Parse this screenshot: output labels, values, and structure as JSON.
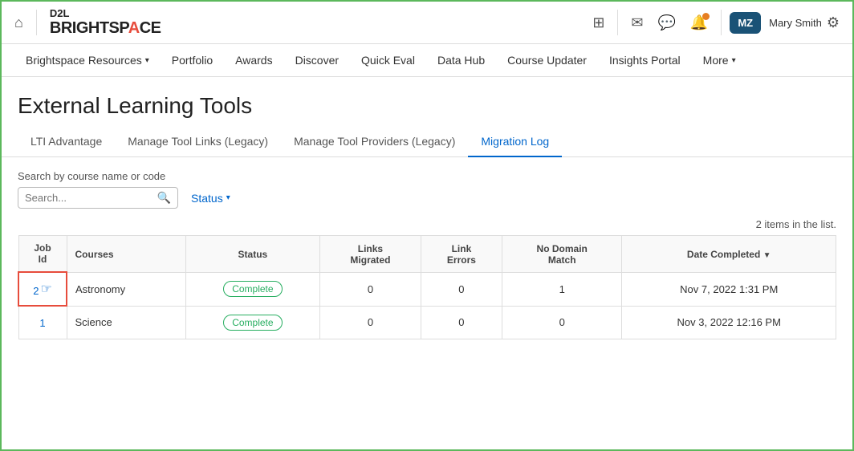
{
  "topbar": {
    "logo_d2l": "D2L",
    "logo_bright": "BRIGHTSP",
    "logo_ace": "ACE",
    "user_initials": "MZ",
    "user_name": "Mary Smith"
  },
  "navbar": {
    "items": [
      {
        "label": "Brightspace Resources",
        "dropdown": true
      },
      {
        "label": "Portfolio",
        "dropdown": false
      },
      {
        "label": "Awards",
        "dropdown": false
      },
      {
        "label": "Discover",
        "dropdown": false
      },
      {
        "label": "Quick Eval",
        "dropdown": false
      },
      {
        "label": "Data Hub",
        "dropdown": false
      },
      {
        "label": "Course Updater",
        "dropdown": false
      },
      {
        "label": "Insights Portal",
        "dropdown": false
      },
      {
        "label": "More",
        "dropdown": true
      }
    ]
  },
  "page": {
    "title": "External Learning Tools"
  },
  "tabs": [
    {
      "label": "LTI Advantage",
      "active": false
    },
    {
      "label": "Manage Tool Links (Legacy)",
      "active": false
    },
    {
      "label": "Manage Tool Providers (Legacy)",
      "active": false
    },
    {
      "label": "Migration Log",
      "active": true
    }
  ],
  "search": {
    "label": "Search by course name or code",
    "placeholder": "Search...",
    "status_label": "Status"
  },
  "items_count": "2 items in the list.",
  "table": {
    "columns": [
      {
        "key": "job_id",
        "label": "Job\nId"
      },
      {
        "key": "courses",
        "label": "Courses"
      },
      {
        "key": "status",
        "label": "Status"
      },
      {
        "key": "links_migrated",
        "label": "Links\nMigrated"
      },
      {
        "key": "link_errors",
        "label": "Link\nErrors"
      },
      {
        "key": "no_domain_match",
        "label": "No Domain\nMatch"
      },
      {
        "key": "date_completed",
        "label": "Date Completed"
      }
    ],
    "rows": [
      {
        "job_id": "2",
        "courses": "Astronomy",
        "status": "Complete",
        "links_migrated": "0",
        "link_errors": "0",
        "no_domain_match": "1",
        "date_completed": "Nov 7, 2022 1:31 PM",
        "highlight": true
      },
      {
        "job_id": "1",
        "courses": "Science",
        "status": "Complete",
        "links_migrated": "0",
        "link_errors": "0",
        "no_domain_match": "0",
        "date_completed": "Nov 3, 2022 12:16 PM",
        "highlight": false
      }
    ]
  }
}
